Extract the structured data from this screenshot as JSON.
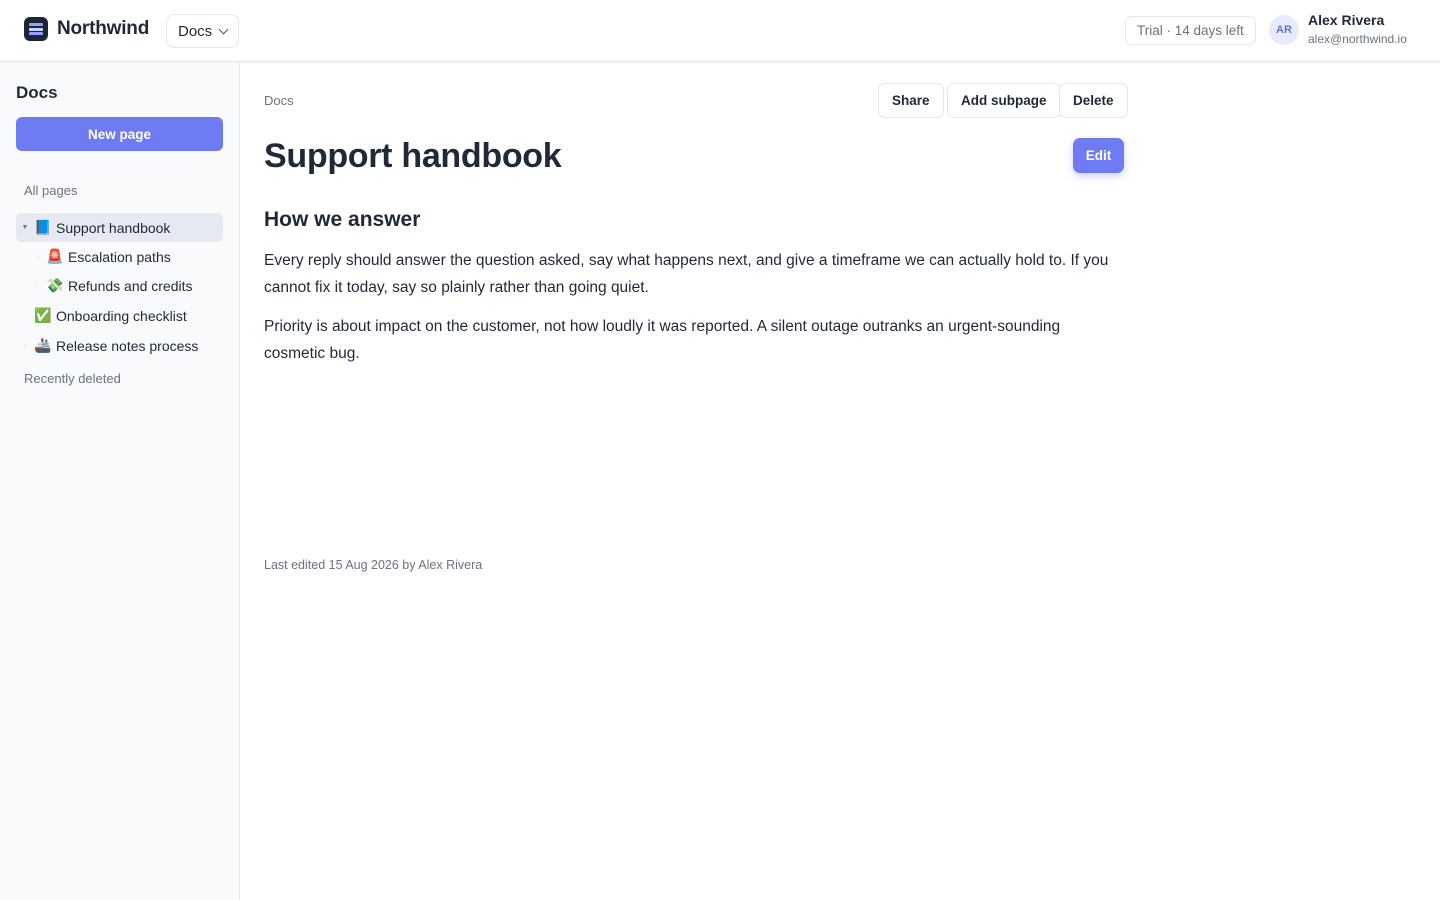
{
  "header": {
    "brand_name": "Northwind",
    "workspace": "Docs",
    "trial": "Trial · 14 days left",
    "user": {
      "initials": "AR",
      "name": "Alex Rivera",
      "email": "alex@northwind.io"
    }
  },
  "sidebar": {
    "title": "Docs",
    "new_page": "New page",
    "all_pages": "All pages",
    "recently_deleted": "Recently deleted",
    "items": [
      {
        "emoji": "📘",
        "label": "Support handbook",
        "active": true,
        "expanded": true
      },
      {
        "emoji": "🚨",
        "label": "Escalation paths",
        "child": true
      },
      {
        "emoji": "💸",
        "label": "Refunds and credits",
        "child": true
      },
      {
        "emoji": "✅",
        "label": "Onboarding checklist"
      },
      {
        "emoji": "🚢",
        "label": "Release notes process"
      }
    ]
  },
  "main": {
    "breadcrumb": "Docs",
    "actions": {
      "share": "Share",
      "add_subpage": "Add subpage",
      "delete": "Delete",
      "edit": "Edit"
    },
    "title": "Support handbook",
    "heading": "How we answer",
    "paragraphs": [
      "Every reply should answer the question asked, say what happens next, and give a timeframe we can actually hold to. If you cannot fix it today, say so plainly rather than going quiet.",
      "Priority is about impact on the customer, not how loudly it was reported. A silent outage outranks an urgent-sounding cosmetic bug."
    ],
    "last_edited": "Last edited 15 Aug 2026 by Alex Rivera"
  },
  "colors": {
    "accent": "#6e7bf2",
    "sidebar_bg": "#f9fafc",
    "text": "#1f2937",
    "muted": "#6b7280"
  }
}
